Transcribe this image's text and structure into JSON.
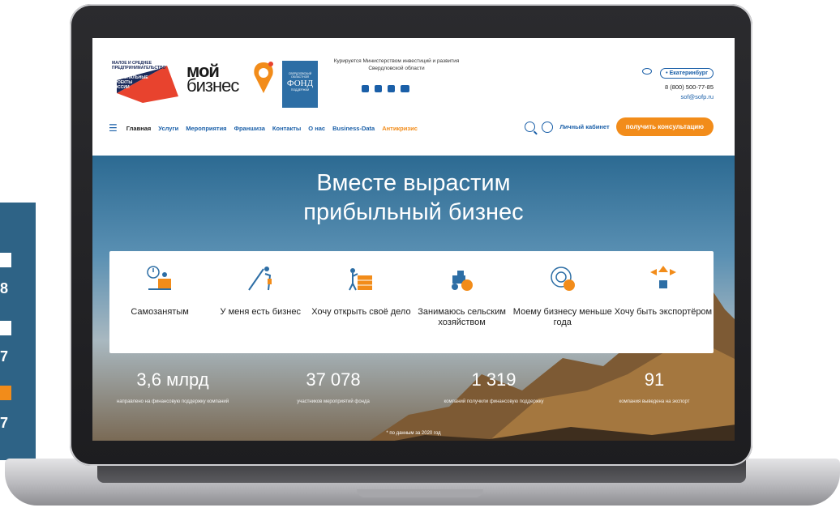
{
  "side_panel": {
    "numbers": [
      "8",
      "7",
      "7"
    ]
  },
  "header": {
    "logo_text": [
      "МАЛОЕ И СРЕДНЕЕ",
      "ПРЕДПРИНИМАТЕЛЬСТВО",
      "НАЦИОНАЛЬНЫЕ",
      "ПРОЕКТЫ",
      "РОССИИ"
    ],
    "brand_line1": "мой",
    "brand_line2": "бизнес",
    "fund_logo_text": [
      "СВЕРДЛОВСКИЙ",
      "ОБЛАСТНОЙ",
      "ФОНД",
      "ПОДДЕРЖКИ"
    ],
    "supervision": "Курируется Министерством инвестиций и развития Свердловской области",
    "social_icons": [
      "instagram-icon",
      "vk-icon",
      "facebook-icon",
      "youtube-icon"
    ],
    "city": "Екатеринбург",
    "phone": "8 (800) 500-77-85",
    "email": "sof@sofp.ru"
  },
  "nav": {
    "items": [
      "Главная",
      "Услуги",
      "Мероприятия",
      "Франшиза",
      "Контакты",
      "О нас",
      "Business-Data",
      "Антикризис"
    ],
    "cabinet": "Личный кабинет",
    "consult_button": "получить консультацию"
  },
  "hero": {
    "title_line1": "Вместе вырастим",
    "title_line2": "прибыльный бизнес",
    "cards": [
      {
        "label": "Самозанятым",
        "icon": "self-employed-icon"
      },
      {
        "label": "У меня есть бизнес",
        "icon": "business-owner-icon"
      },
      {
        "label": "Хочу открыть своё дело",
        "icon": "build-wall-icon"
      },
      {
        "label": "Занимаюсь сельским хозяйством",
        "icon": "tractor-icon"
      },
      {
        "label": "Моему бизнесу меньше года",
        "icon": "globe-target-icon"
      },
      {
        "label": "Хочу быть экспортёром",
        "icon": "export-arrows-icon"
      }
    ],
    "stats": [
      {
        "value": "3,6 млрд",
        "desc": "направлено на финансовую поддержку компаний"
      },
      {
        "value": "37 078",
        "desc": "участников мероприятий фонда"
      },
      {
        "value": "1 319",
        "desc": "компаний получили финансовую поддержку"
      },
      {
        "value": "91",
        "desc": "компания выведена на экспорт"
      }
    ],
    "footnote": "* по данным за 2020 год"
  },
  "colors": {
    "accent": "#f28c1a",
    "brand_blue": "#1a5fa8",
    "side_panel": "#2e6386"
  }
}
